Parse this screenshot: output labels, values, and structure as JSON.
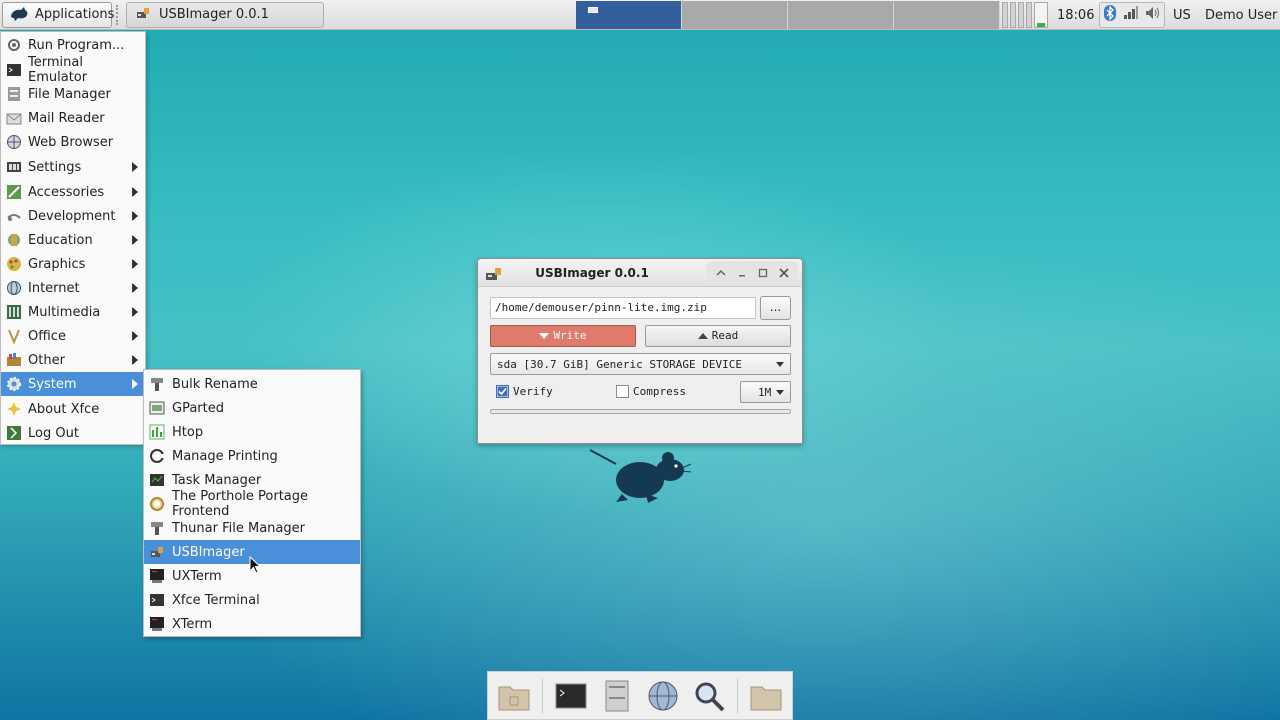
{
  "top_panel": {
    "applications_label": "Applications",
    "task_label": "USBImager 0.0.1",
    "clock": "18:06",
    "keyboard_layout": "US",
    "user": "Demo User"
  },
  "app_menu": {
    "items": [
      {
        "label": "Run Program...",
        "icon": "run-icon"
      },
      {
        "label": "Terminal Emulator",
        "icon": "terminal-icon"
      },
      {
        "label": "File Manager",
        "icon": "file-manager-icon"
      },
      {
        "label": "Mail Reader",
        "icon": "mail-icon"
      },
      {
        "label": "Web Browser",
        "icon": "globe-icon"
      },
      {
        "label": "Settings",
        "icon": "settings-icon"
      },
      {
        "label": "Accessories",
        "icon": "accessories-icon"
      },
      {
        "label": "Development",
        "icon": "development-icon"
      },
      {
        "label": "Education",
        "icon": "education-icon"
      },
      {
        "label": "Graphics",
        "icon": "graphics-icon"
      },
      {
        "label": "Internet",
        "icon": "internet-icon"
      },
      {
        "label": "Multimedia",
        "icon": "multimedia-icon"
      },
      {
        "label": "Office",
        "icon": "office-icon"
      },
      {
        "label": "Other",
        "icon": "other-icon"
      },
      {
        "label": "System",
        "icon": "system-icon"
      },
      {
        "label": "About Xfce",
        "icon": "about-icon"
      },
      {
        "label": "Log Out",
        "icon": "logout-icon"
      }
    ]
  },
  "system_menu": {
    "items": [
      {
        "label": "Bulk Rename",
        "icon": "bulk-rename-icon"
      },
      {
        "label": "GParted",
        "icon": "gparted-icon"
      },
      {
        "label": "Htop",
        "icon": "htop-icon"
      },
      {
        "label": "Manage Printing",
        "icon": "printing-icon"
      },
      {
        "label": "Task Manager",
        "icon": "task-manager-icon"
      },
      {
        "label": "The Porthole Portage Frontend",
        "icon": "porthole-icon"
      },
      {
        "label": "Thunar File Manager",
        "icon": "thunar-icon"
      },
      {
        "label": "USBImager",
        "icon": "usbimager-icon"
      },
      {
        "label": "UXTerm",
        "icon": "uxterm-icon"
      },
      {
        "label": "Xfce Terminal",
        "icon": "xfce-terminal-icon"
      },
      {
        "label": "XTerm",
        "icon": "xterm-icon"
      }
    ]
  },
  "usbimager": {
    "title": "USBImager 0.0.1",
    "image_path": "/home/demouser/pinn-lite.img.zip",
    "browse_label": "...",
    "write_label": "Write",
    "read_label": "Read",
    "device": "sda [30.7 GiB] Generic STORAGE DEVICE",
    "verify_label": "Verify",
    "verify_checked": true,
    "compress_label": "Compress",
    "compress_checked": false,
    "block_size": "1M",
    "progress": 0
  },
  "colors": {
    "accent": "#4a90d9",
    "write_button": "#e07b6c",
    "workspace_active": "#33609c"
  }
}
